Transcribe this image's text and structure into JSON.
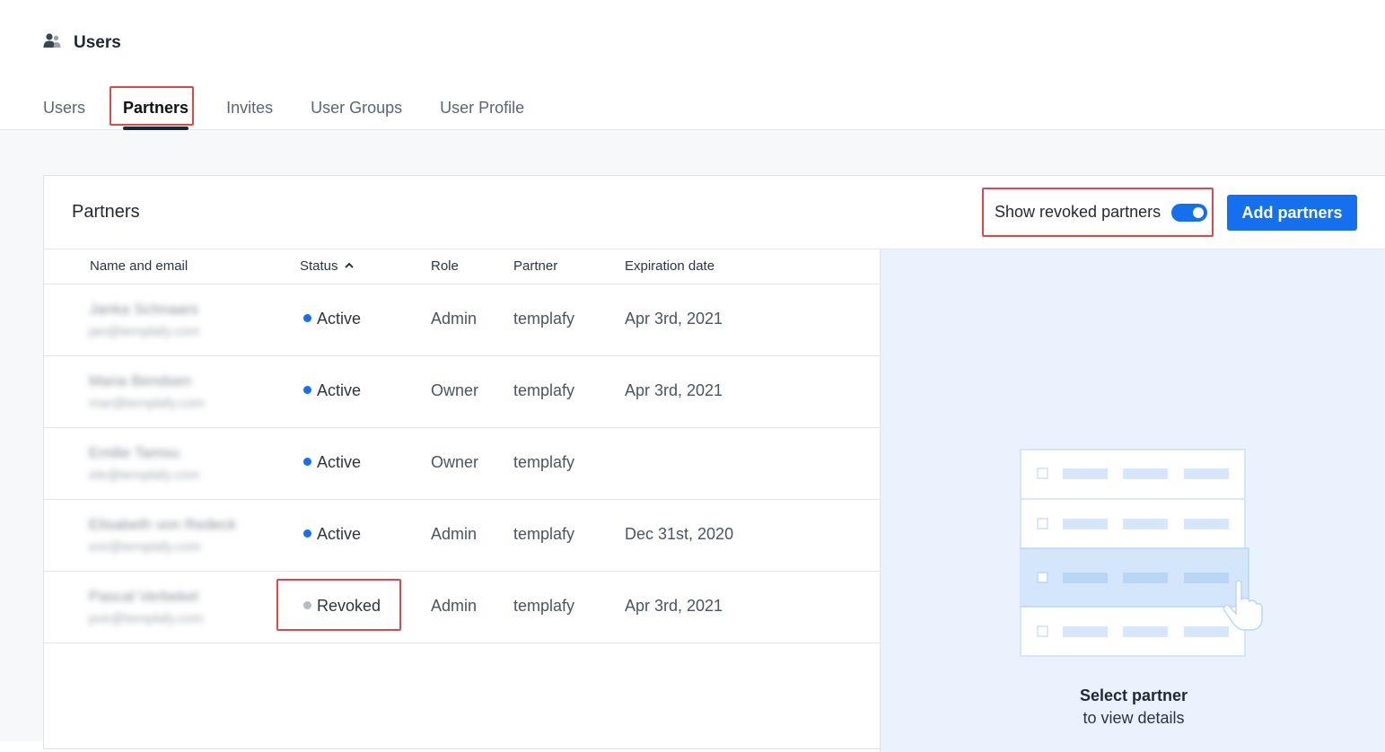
{
  "app": {
    "title": "Users",
    "icon": "users-icon"
  },
  "tabs": [
    {
      "label": "Users",
      "active": false
    },
    {
      "label": "Partners",
      "active": true
    },
    {
      "label": "Invites",
      "active": false
    },
    {
      "label": "User Groups",
      "active": false
    },
    {
      "label": "User Profile",
      "active": false
    }
  ],
  "panel": {
    "title": "Partners",
    "toggle_label": "Show revoked partners",
    "toggle_on": true,
    "add_button": "Add partners"
  },
  "table": {
    "columns": [
      "Name and email",
      "Status",
      "Role",
      "Partner",
      "Expiration date"
    ],
    "sort_indicator": "chevron-up-icon",
    "rows": [
      {
        "name": "Janka Schnaars",
        "email": "jan@templafy.com",
        "status": "Active",
        "role": "Admin",
        "partner": "templafy",
        "expiration": "Apr 3rd, 2021"
      },
      {
        "name": "Maria Bendsen",
        "email": "mar@templafy.com",
        "status": "Active",
        "role": "Owner",
        "partner": "templafy",
        "expiration": "Apr 3rd, 2021"
      },
      {
        "name": "Emilie Tamsu",
        "email": "ele@templafy.com",
        "status": "Active",
        "role": "Owner",
        "partner": "templafy",
        "expiration": ""
      },
      {
        "name": "Elisabeth von Redeck",
        "email": "eor@templafy.com",
        "status": "Active",
        "role": "Admin",
        "partner": "templafy",
        "expiration": "Dec 31st, 2020"
      },
      {
        "name": "Pascal Verbekel",
        "email": "pve@templafy.com",
        "status": "Revoked",
        "role": "Admin",
        "partner": "templafy",
        "expiration": "Apr 3rd, 2021"
      }
    ]
  },
  "side": {
    "line1": "Select partner",
    "line2": "to view details"
  },
  "colors": {
    "accent": "#1570ef",
    "active_dot": "#1570ef",
    "revoked_dot": "#b6bcc3",
    "highlight": "#e0474c"
  }
}
